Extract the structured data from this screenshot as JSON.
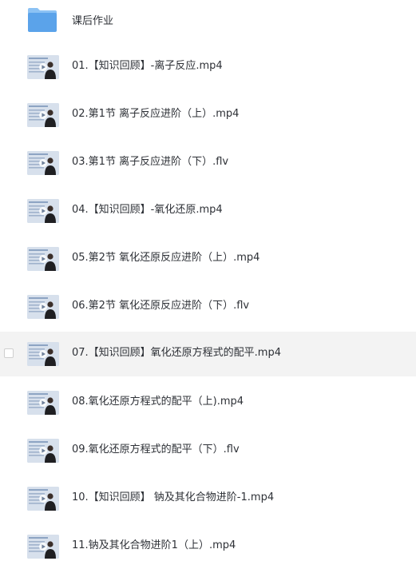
{
  "files": [
    {
      "name": "课后作业",
      "icon": "folder-icon"
    },
    {
      "name": "01.【知识回顾】-离子反应.mp4",
      "icon": "video-thumbnail-icon"
    },
    {
      "name": "02.第1节 离子反应进阶（上）.mp4",
      "icon": "video-thumbnail-icon"
    },
    {
      "name": "03.第1节 离子反应进阶（下）.flv",
      "icon": "video-thumbnail-icon"
    },
    {
      "name": "04.【知识回顾】-氧化还原.mp4",
      "icon": "video-thumbnail-icon"
    },
    {
      "name": "05.第2节 氧化还原反应进阶（上）.mp4",
      "icon": "video-thumbnail-icon"
    },
    {
      "name": "06.第2节 氧化还原反应进阶（下）.flv",
      "icon": "video-thumbnail-icon"
    },
    {
      "name": "07.【知识回顾】氧化还原方程式的配平.mp4",
      "icon": "video-thumbnail-icon",
      "hovered": true
    },
    {
      "name": "08.氧化还原方程式的配平（上).mp4",
      "icon": "video-thumbnail-icon"
    },
    {
      "name": "09.氧化还原方程式的配平（下）.flv",
      "icon": "video-thumbnail-icon"
    },
    {
      "name": "10.【知识回顾】 钠及其化合物进阶-1.mp4",
      "icon": "video-thumbnail-icon"
    },
    {
      "name": "11.钠及其化合物进阶1（上）.mp4",
      "icon": "video-thumbnail-icon"
    }
  ],
  "colors": {
    "folder": "#5ba3ea",
    "folder_tab": "#8cc2f4",
    "hover_background": "#f3f3f3",
    "text": "#2d3036"
  }
}
